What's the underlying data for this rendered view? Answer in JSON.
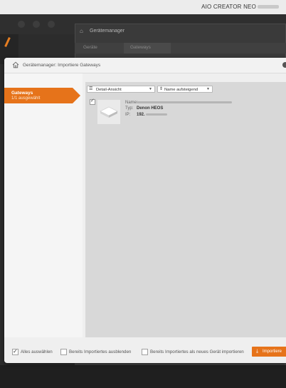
{
  "app": {
    "title": "AIO CREATOR NEO"
  },
  "background_window": {
    "title": "Gerätemanager",
    "tabs": [
      "Geräte",
      "Gateways"
    ]
  },
  "dialog": {
    "title": "Gerätemanager: Importiere Gateways",
    "nav": {
      "label": "Gateways",
      "sub": "1/1 ausgewählt"
    },
    "toolbar": {
      "view_select": "Detail-Ansicht",
      "sort_select": "Name aufsteigend"
    },
    "device": {
      "name_key": "Name:",
      "type_key": "Typ:",
      "type_value": "Denon HEOS",
      "ip_key": "IP:",
      "ip_value": "192."
    },
    "footer": {
      "select_all": "Alles auswählen",
      "hide_imported": "Bereits Importiertes ausblenden",
      "import_as_new": "Bereits Importiertes als neues Gerät importieren",
      "import_button": "Importiere"
    }
  },
  "colors": {
    "accent": "#e6731a"
  }
}
